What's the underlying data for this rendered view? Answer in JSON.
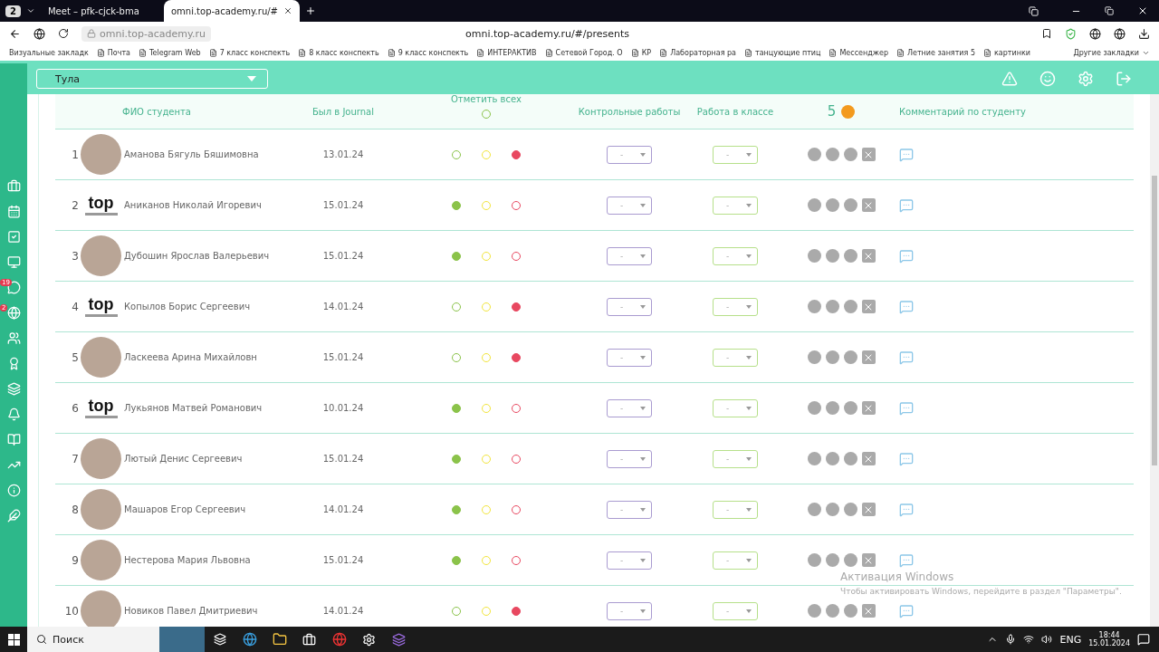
{
  "browser": {
    "tab_count": "2",
    "tabs": [
      {
        "title": "Meet – pfk-cjck-bma",
        "selected": false
      },
      {
        "title": "omni.top-academy.ru/#",
        "selected": true
      }
    ],
    "address_host": "omni.top-academy.ru",
    "page_url": "omni.top-academy.ru/#/presents",
    "bookmarks": [
      "Визуальные закладк",
      "Почта",
      "Telegram Web",
      "7 класс конспекть",
      "8 класс конспекть",
      "9 класс конспекть",
      "ИНТЕРАКТИВ",
      "Сетевой Город. О",
      "КР",
      "Лабораторная ра",
      "танцующие птиц",
      "Мессенджер",
      "Летние занятия 5",
      "картинки"
    ],
    "other_bookmarks": "Другие закладки"
  },
  "sidebar": {
    "badges": [
      "19",
      "2"
    ]
  },
  "header": {
    "city": "Тула"
  },
  "table": {
    "columns": {
      "name": "ФИО студента",
      "journal": "Был в Journal",
      "mark_all": "Отметить всех",
      "tests": "Контрольные работы",
      "classwork": "Работа в классе",
      "coins": "5",
      "comment": "Комментарий по студенту"
    },
    "mark_all_checked": false,
    "rows": [
      {
        "number": "1",
        "name": "Аманова Бягуль Бяшимовна",
        "date": "13.01.24",
        "present": false,
        "late": false,
        "absent": true,
        "test": "-",
        "classwork": "-"
      },
      {
        "number": "2",
        "logo_text": "top",
        "name": "Аниканов Николай Игоревич",
        "date": "15.01.24",
        "present": true,
        "late": false,
        "absent": false,
        "test": "-",
        "classwork": "-"
      },
      {
        "number": "3",
        "name": "Дубошин Ярослав Валерьевич",
        "date": "15.01.24",
        "present": true,
        "late": false,
        "absent": false,
        "test": "-",
        "classwork": "-"
      },
      {
        "number": "4",
        "logo_text": "top",
        "name": "Копылов Борис Сергеевич",
        "date": "14.01.24",
        "present": false,
        "late": false,
        "absent": true,
        "test": "-",
        "classwork": "-"
      },
      {
        "number": "5",
        "name": "Ласкеева Арина Михайловн",
        "date": "15.01.24",
        "present": false,
        "late": false,
        "absent": true,
        "test": "-",
        "classwork": "-"
      },
      {
        "number": "6",
        "logo_text": "top",
        "name": "Лукьянов Матвей Романович",
        "date": "10.01.24",
        "present": true,
        "late": false,
        "absent": false,
        "test": "-",
        "classwork": "-"
      },
      {
        "number": "7",
        "name": "Лютый Денис Сергеевич",
        "date": "15.01.24",
        "present": true,
        "late": false,
        "absent": false,
        "test": "-",
        "classwork": "-"
      },
      {
        "number": "8",
        "name": "Машаров Егор Сергеевич",
        "date": "14.01.24",
        "present": true,
        "late": false,
        "absent": false,
        "test": "-",
        "classwork": "-"
      },
      {
        "number": "9",
        "name": "Нестерова Мария Львовна",
        "date": "15.01.24",
        "present": true,
        "late": false,
        "absent": false,
        "test": "-",
        "classwork": "-"
      },
      {
        "number": "10",
        "name": "Новиков Павел Дмитриевич",
        "date": "14.01.24",
        "present": false,
        "late": false,
        "absent": true,
        "test": "-",
        "classwork": "-"
      }
    ]
  },
  "activation": {
    "title": "Активация Windows",
    "text": "Чтобы активировать Windows, перейдите в раздел \"Параметры\"."
  },
  "taskbar": {
    "search": "Поиск",
    "language": "ENG",
    "time": "18:44",
    "date": "15.01.2024"
  }
}
